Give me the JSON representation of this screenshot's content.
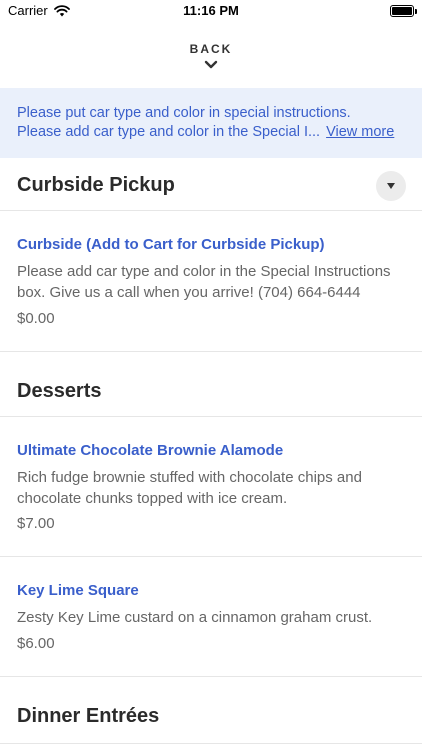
{
  "status": {
    "carrier": "Carrier",
    "time": "11:16 PM",
    "icons": {
      "wifi": "wifi-icon",
      "battery": "battery-icon"
    }
  },
  "header": {
    "back_label": "BACK",
    "back_icon": "chevron-down-icon"
  },
  "notice": {
    "line1": "Please put car type and color in special instructions.",
    "line2": "Please add car type and color in the Special I...",
    "view_more": "View more",
    "colors": {
      "background": "#eaf0fb",
      "text": "#3a5fcb"
    }
  },
  "sections": [
    {
      "title": "Curbside Pickup",
      "collapse_icon": "caret-down-icon",
      "items": [
        {
          "name": "Curbside (Add to Cart for Curbside Pickup)",
          "description_line1": "Please add car type and color in the Special Instructions",
          "description_line2": "box. Give us a call when you arrive! (704) 664-6444",
          "price": "$0.00"
        }
      ]
    },
    {
      "title": "Desserts",
      "items": [
        {
          "name": "Ultimate Chocolate Brownie Alamode",
          "description_line1": "Rich fudge brownie stuffed with chocolate chips and",
          "description_line2": "chocolate chunks topped with ice cream.",
          "price": "$7.00"
        },
        {
          "name": "Key Lime Square",
          "description_line1": "Zesty Key Lime custard on a cinnamon graham crust.",
          "price": "$6.00"
        }
      ]
    },
    {
      "title": "Dinner Entrées"
    }
  ],
  "colors": {
    "accent": "#3a5fcb",
    "divider": "#e6e6e6",
    "muted_text": "#666666"
  }
}
